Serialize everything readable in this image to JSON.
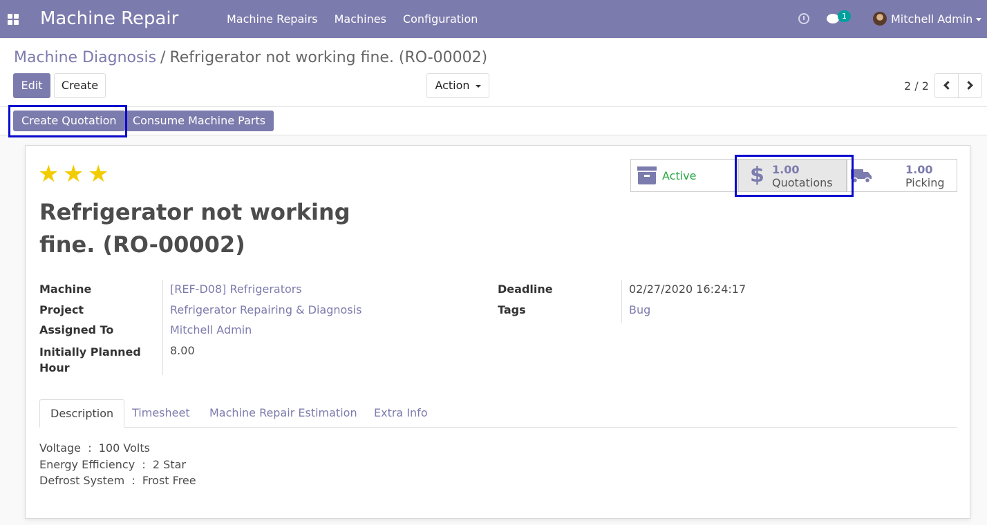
{
  "navbar": {
    "app_title": "Machine Repair",
    "menu": [
      "Machine Repairs",
      "Machines",
      "Configuration"
    ],
    "chat_badge": "1",
    "user_name": "Mitchell Admin",
    "bg_color": "#7c7bad"
  },
  "breadcrumb": {
    "parent": "Machine Diagnosis",
    "separator": "/",
    "current": "Refrigerator not working fine. (RO-00002)"
  },
  "control": {
    "edit_label": "Edit",
    "create_label": "Create",
    "action_label": "Action",
    "pager": "2 / 2"
  },
  "header_buttons": {
    "quotation": "Create Quotation",
    "consume": "Consume Machine Parts"
  },
  "record": {
    "stars": 3,
    "title_line1": "Refrigerator not working",
    "title_line2": "fine. (RO-00002)"
  },
  "stats": {
    "active_label": "Active",
    "quotations_value": "1.00",
    "quotations_label": "Quotations",
    "picking_value": "1.00",
    "picking_label": "Picking"
  },
  "fields": {
    "machine_label": "Machine",
    "machine_value": "[REF-D08] Refrigerators",
    "project_label": "Project",
    "project_value": "Refrigerator Repairing & Diagnosis",
    "assigned_label": "Assigned To",
    "assigned_value": "Mitchell Admin",
    "hours_label_1": "Initially Planned",
    "hours_label_2": "Hour",
    "hours_value": "8.00",
    "deadline_label": "Deadline",
    "deadline_value": "02/27/2020 16:24:17",
    "tags_label": "Tags",
    "tags_value": "Bug"
  },
  "tabs": [
    "Description",
    "Timesheet",
    "Machine Repair Estimation",
    "Extra Info"
  ],
  "description": [
    "Voltage  :  100 Volts",
    "Energy Efficiency  :  2 Star",
    "Defrost System  :  Frost Free"
  ],
  "colors": {
    "primary": "#7c7bad",
    "active_green": "#28a745",
    "star": "#f3cc00",
    "highlight": "#0b0bcf"
  }
}
